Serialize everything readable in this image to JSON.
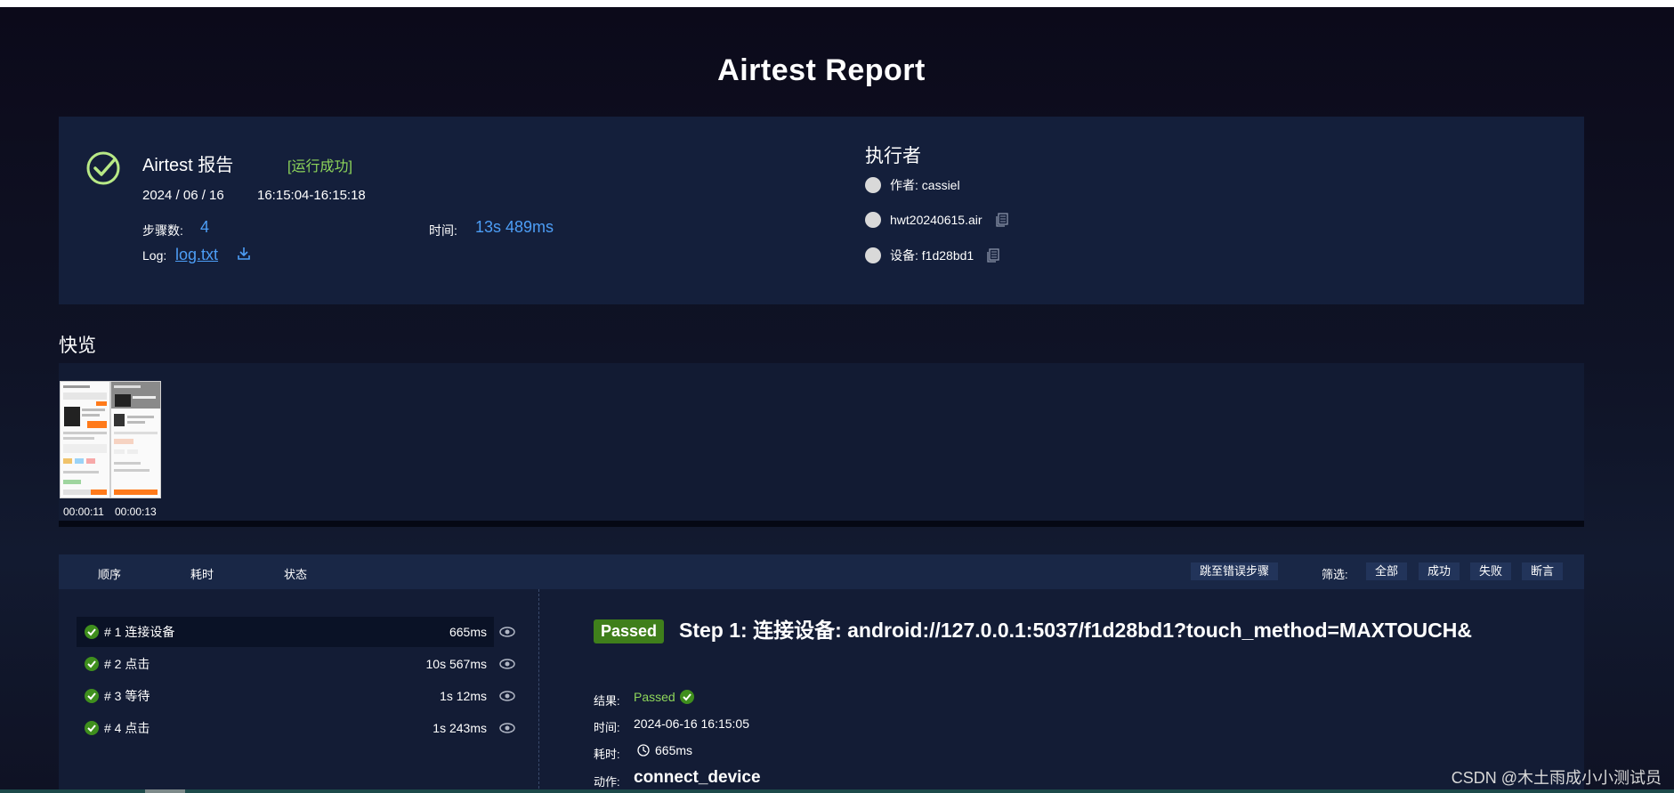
{
  "page": {
    "title": "Airtest Report"
  },
  "summary": {
    "report_name": "Airtest 报告",
    "run_status": "[运行成功]",
    "date": "2024 / 06 / 16",
    "time_range": "16:15:04-16:15:18",
    "steps_label": "步骤数:",
    "steps_value": "4",
    "duration_label": "时间:",
    "duration_value": "13s 489ms",
    "log_label": "Log:",
    "log_link": "log.txt"
  },
  "executor": {
    "title": "执行者",
    "author": "作者:  cassiel",
    "script": "hwt20240615.air",
    "device": "设备:  f1d28bd1"
  },
  "overview": {
    "title": "快览",
    "thumbnails": [
      {
        "label": "00:00:11"
      },
      {
        "label": "00:00:13"
      }
    ]
  },
  "steps_panel": {
    "headers": {
      "order": "顺序",
      "elapsed": "耗时",
      "status": "状态"
    },
    "jump_error": "跳至错误步骤",
    "filter_label": "筛选:",
    "filters": [
      "全部",
      "成功",
      "失败",
      "断言"
    ],
    "steps": [
      {
        "name": "# 1 连接设备",
        "time": "665ms"
      },
      {
        "name": "# 2 点击",
        "time": "10s 567ms"
      },
      {
        "name": "# 3 等待",
        "time": "1s 12ms"
      },
      {
        "name": "# 4 点击",
        "time": "1s 243ms"
      }
    ]
  },
  "detail": {
    "badge": "Passed",
    "title": "Step 1: 连接设备:  android://127.0.0.1:5037/f1d28bd1?touch_method=MAXTOUCH&",
    "result_label": "结果:",
    "result_value": "Passed",
    "time_label": "时间:",
    "time_value": "2024-06-16 16:15:05",
    "elapsed_label": "耗时:",
    "elapsed_value": "665ms",
    "action_label": "动作:",
    "action_value": "connect_device"
  },
  "watermark": "CSDN @木土雨成小小测试员",
  "colors": {
    "accent_blue": "#4d9ef6",
    "success_green": "#8ed65a",
    "badge_green": "#3f7f1b",
    "panel": "#141f3b"
  }
}
